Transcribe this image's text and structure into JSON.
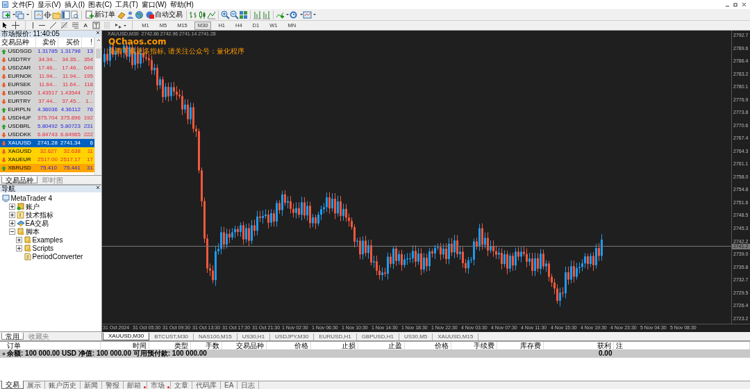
{
  "menu": [
    {
      "label": "文件(F)"
    },
    {
      "label": "显示(V)"
    },
    {
      "label": "插入(I)"
    },
    {
      "label": "图表(C)"
    },
    {
      "label": "工具(T)"
    },
    {
      "label": "窗口(W)"
    },
    {
      "label": "帮助(H)"
    }
  ],
  "toolbar": {
    "new_order": "新订单",
    "auto_trading": "自动交易",
    "text_tool": "A"
  },
  "timeframes": [
    {
      "label": "M1",
      "selected": false
    },
    {
      "label": "M5",
      "selected": false
    },
    {
      "label": "M15",
      "selected": false
    },
    {
      "label": "M30",
      "selected": true
    },
    {
      "label": "H1",
      "selected": false
    },
    {
      "label": "H4",
      "selected": false
    },
    {
      "label": "D1",
      "selected": false
    },
    {
      "label": "W1",
      "selected": false
    },
    {
      "label": "MN",
      "selected": false
    }
  ],
  "market_watch": {
    "title": "市场报价: 11:40:05",
    "columns": [
      "交易品种",
      "卖价",
      "买价",
      "!"
    ],
    "rows": [
      {
        "symbol": "USDSGD",
        "bid": "1.31785",
        "ask": "1.31798",
        "spread": "13",
        "rising": true,
        "selected": false
      },
      {
        "symbol": "USDTRY",
        "bid": "34.34...",
        "ask": "34.35...",
        "spread": "354",
        "rising": false,
        "selected": false
      },
      {
        "symbol": "USDZAR",
        "bid": "17.46...",
        "ask": "17.46...",
        "spread": "649",
        "rising": false,
        "selected": false
      },
      {
        "symbol": "EURNOK",
        "bid": "11.94...",
        "ask": "11.94...",
        "spread": "195",
        "rising": false,
        "selected": false
      },
      {
        "symbol": "EURSEK",
        "bid": "11.64...",
        "ask": "11.64...",
        "spread": "118",
        "rising": false,
        "selected": false
      },
      {
        "symbol": "EURSGD",
        "bid": "1.43517",
        "ask": "1.43544",
        "spread": "27",
        "rising": false,
        "selected": false
      },
      {
        "symbol": "EURTRY",
        "bid": "37.44...",
        "ask": "37.45...",
        "spread": "1...",
        "rising": false,
        "selected": false
      },
      {
        "symbol": "EURPLN",
        "bid": "4.36036",
        "ask": "4.36112",
        "spread": "76",
        "rising": true,
        "selected": false
      },
      {
        "symbol": "USDHUF",
        "bid": "375.704",
        "ask": "375.896",
        "spread": "192",
        "rising": false,
        "selected": false
      },
      {
        "symbol": "USDBRL",
        "bid": "5.80492",
        "ask": "5.80723",
        "spread": "231",
        "rising": true,
        "selected": false
      },
      {
        "symbol": "USDDKK",
        "bid": "6.84743",
        "ask": "6.84965",
        "spread": "222",
        "rising": false,
        "selected": false
      },
      {
        "symbol": "XAUUSD",
        "bid": "2741.28",
        "ask": "2741.34",
        "spread": "6",
        "rising": false,
        "selected": true
      },
      {
        "symbol": "XAGUSD",
        "bid": "32.627",
        "ask": "32.638",
        "spread": "11",
        "rising": false,
        "color": "#ffd200",
        "selected": false
      },
      {
        "symbol": "XAUEUR",
        "bid": "2517.00",
        "ask": "2517.17",
        "spread": "17",
        "rising": false,
        "color": "#ffd200",
        "selected": false
      },
      {
        "symbol": "XBRUSD",
        "bid": "75.410",
        "ask": "75.441",
        "spread": "31",
        "rising": true,
        "color": "#ffa500",
        "selected": false
      }
    ],
    "tabs": [
      {
        "label": "交易品种",
        "selected": true
      },
      {
        "label": "即时图",
        "selected": false
      }
    ]
  },
  "navigator": {
    "title": "导航",
    "tree": [
      {
        "label": "MetaTrader 4",
        "kind": "terminal",
        "children": [
          {
            "label": "账户",
            "kind": "accounts",
            "expanded": false
          },
          {
            "label": "技术指标",
            "kind": "indicators",
            "expanded": false
          },
          {
            "label": "EA交易",
            "kind": "experts",
            "expanded": false
          },
          {
            "label": "脚本",
            "kind": "scripts",
            "expanded": true,
            "children": [
              {
                "label": "Examples",
                "kind": "scripts",
                "expanded": false
              },
              {
                "label": "Scripts",
                "kind": "scripts",
                "expanded": false
              },
              {
                "label": "PeriodConverter",
                "kind": "script"
              }
            ]
          }
        ]
      }
    ],
    "tabs": [
      {
        "label": "常用",
        "selected": true
      },
      {
        "label": "收藏夹",
        "selected": false
      }
    ]
  },
  "chart": {
    "header": "XAUUSD,M30  2742.86 2742.96 2741.14 2741.28",
    "overlay_title": "QChaos.com",
    "overlay_text": "免费下载更多指标, 请关注公众号：量化程序",
    "price_ticks": [
      "2792.7",
      "2789.6",
      "2786.4",
      "2783.2",
      "2780.1",
      "2776.9",
      "2773.8",
      "2770.6",
      "2767.4",
      "2764.3",
      "2761.1",
      "2758.0",
      "2754.8",
      "2751.6",
      "2748.5",
      "2745.3",
      "2742.2",
      "2739.0",
      "2735.8",
      "2732.7",
      "2729.5",
      "2726.4",
      "2723.2"
    ],
    "current_price": "2741.2",
    "time_labels": [
      "31 Oct 2024",
      "31 Oct 05:30",
      "31 Oct 09:30",
      "31 Oct 13:30",
      "31 Oct 17:30",
      "31 Oct 21:30",
      "1 Nov 02:30",
      "1 Nov 06:30",
      "1 Nov 10:30",
      "1 Nov 14:30",
      "1 Nov 18:30",
      "1 Nov 22:30",
      "4 Nov 03:30",
      "4 Nov 07:30",
      "4 Nov 11:30",
      "4 Nov 15:30",
      "4 Nov 19:30",
      "4 Nov 23:30",
      "5 Nov 04:30",
      "5 Nov 08:30"
    ]
  },
  "chart_tabs": [
    {
      "label": "XAUUSD,M30",
      "selected": true
    },
    {
      "label": "BTCUST,M30",
      "selected": false
    },
    {
      "label": "NAS100,M15",
      "selected": false
    },
    {
      "label": "US30,H1",
      "selected": false
    },
    {
      "label": "USDJPY,M30",
      "selected": false
    },
    {
      "label": "EURUSD,H1",
      "selected": false
    },
    {
      "label": "GBPUSD,H1",
      "selected": false
    },
    {
      "label": "US30,M5",
      "selected": false
    },
    {
      "label": "XAUUSD,M15",
      "selected": false
    }
  ],
  "terminal": {
    "columns": [
      "订单",
      "时间",
      "类型",
      "手数",
      "交易品种",
      "价格",
      "止损",
      "止盈",
      "价格",
      "手续费",
      "库存费",
      "获利",
      "注"
    ],
    "balance": "余额: 100 000.00 USD  净值: 100 000.00  可用预付款: 100 000.00",
    "profit": "0.00",
    "tabs": [
      {
        "label": "交易",
        "selected": true,
        "notify": false
      },
      {
        "label": "展示",
        "selected": false,
        "notify": false
      },
      {
        "label": "账户历史",
        "selected": false,
        "notify": false
      },
      {
        "label": "新闻",
        "selected": false,
        "notify": false
      },
      {
        "label": "警报",
        "selected": false,
        "notify": false
      },
      {
        "label": "邮箱",
        "selected": false,
        "notify": true
      },
      {
        "label": "市场",
        "selected": false,
        "notify": true
      },
      {
        "label": "文章",
        "selected": false,
        "notify": false
      },
      {
        "label": "代码库",
        "selected": false,
        "notify": false
      },
      {
        "label": "EA",
        "selected": false,
        "notify": false
      },
      {
        "label": "日志",
        "selected": false,
        "notify": false
      }
    ]
  }
}
